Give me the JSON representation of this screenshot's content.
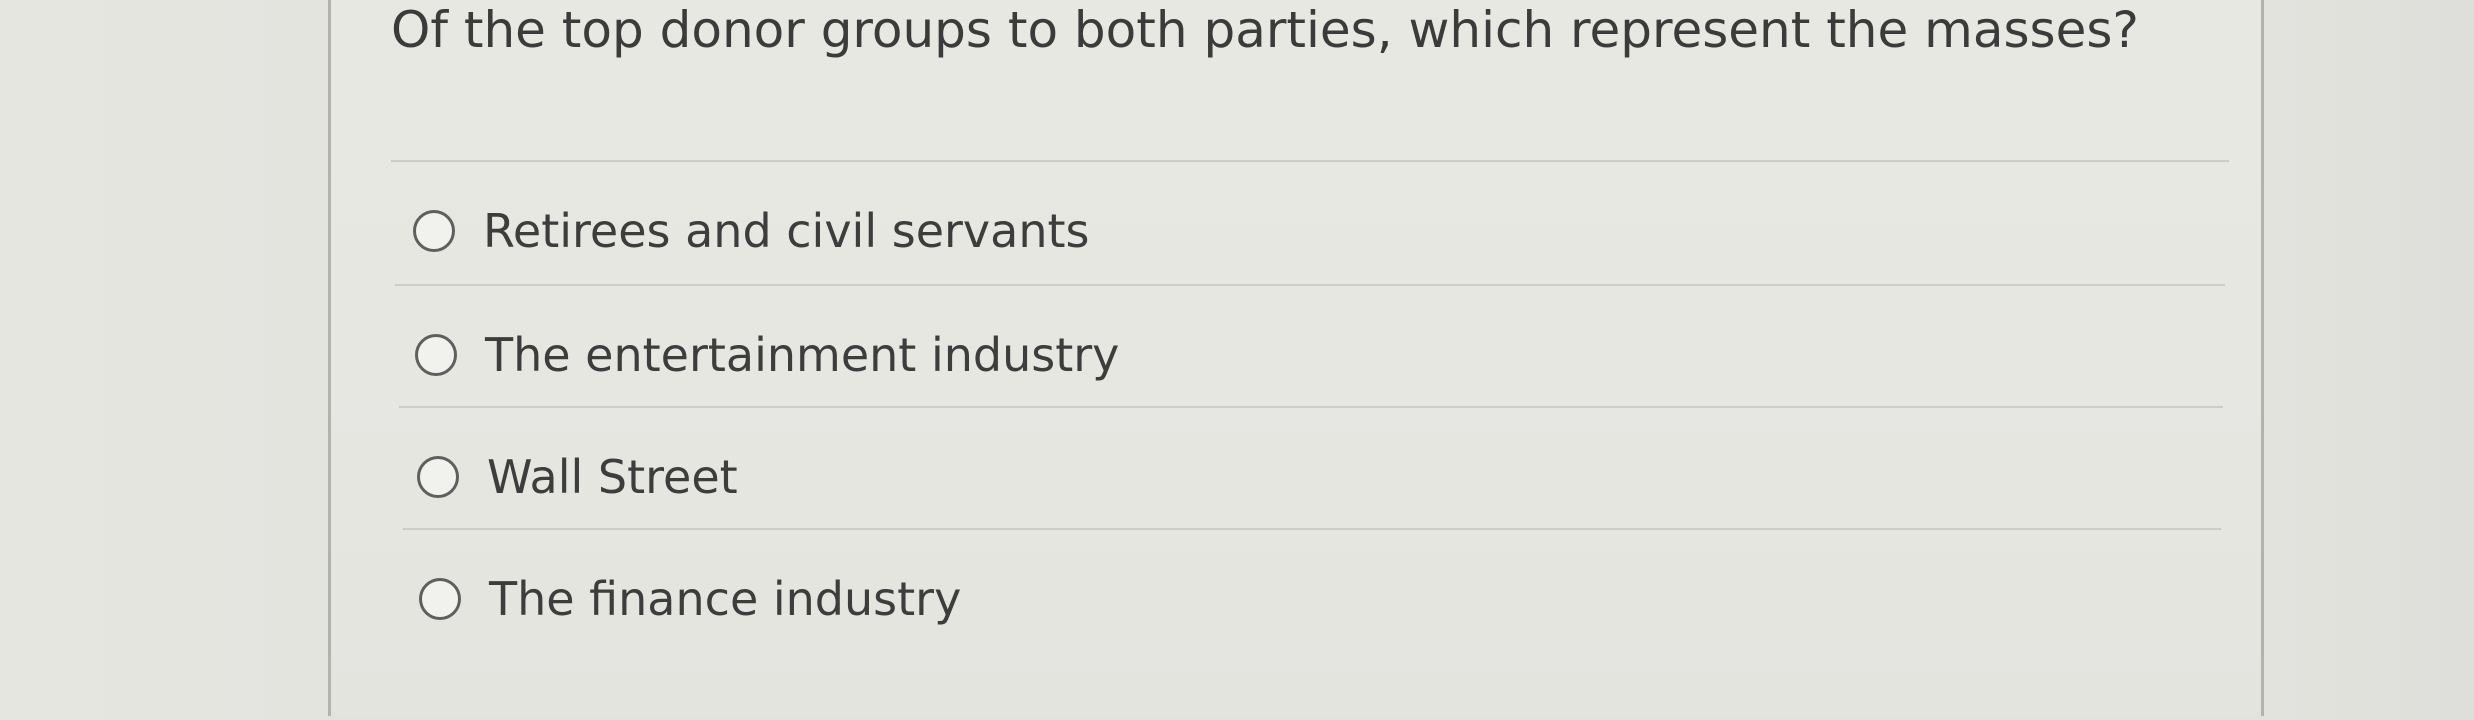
{
  "question": {
    "text": "Of the top donor groups to both parties, which represent the masses?"
  },
  "options": [
    {
      "label": "Retirees and civil servants",
      "selected": false
    },
    {
      "label": "The entertainment industry",
      "selected": false
    },
    {
      "label": "Wall Street",
      "selected": false
    },
    {
      "label": "The finance industry",
      "selected": false
    }
  ],
  "colors": {
    "background": "#e3e3de",
    "panel": "#e7e7e2",
    "text": "#3b3b3b",
    "radio_border": "#5f5f5f",
    "divider": "#cdcdc8"
  }
}
